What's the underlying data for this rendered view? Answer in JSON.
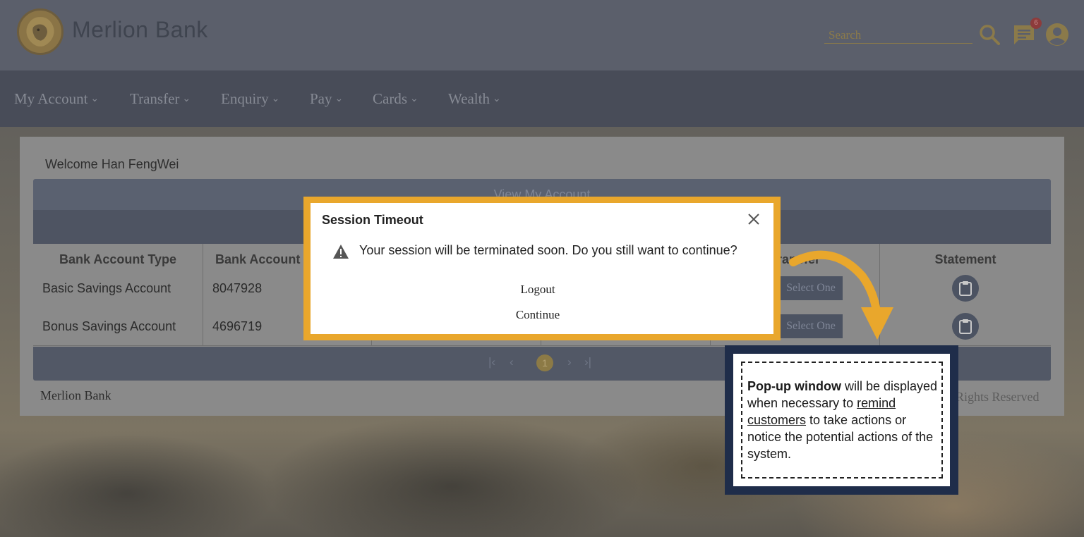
{
  "brand": {
    "name": "Merlion Bank"
  },
  "header": {
    "search_placeholder": "Search",
    "message_count": "6"
  },
  "nav": {
    "items": [
      {
        "label": "My Account"
      },
      {
        "label": "Transfer"
      },
      {
        "label": "Enquiry"
      },
      {
        "label": "Pay"
      },
      {
        "label": "Cards"
      },
      {
        "label": "Wealth"
      }
    ]
  },
  "main": {
    "welcome": "Welcome Han FengWei",
    "table_title": "View My Account",
    "columns": [
      "Bank Account Type",
      "Bank Account",
      "Transfer",
      "Statement"
    ],
    "rows": [
      {
        "type": "Basic Savings Account",
        "number": "8047928",
        "action": "Select One"
      },
      {
        "type": "Bonus Savings Account",
        "number": "4696719",
        "action": "Select One"
      }
    ],
    "pagination": {
      "current_page": "1"
    }
  },
  "footer": {
    "left": "Merlion Bank",
    "right": "Rights Reserved"
  },
  "modal": {
    "title": "Session Timeout",
    "message": "Your session will be terminated soon. Do you still want to continue?",
    "logout_label": "Logout",
    "continue_label": "Continue"
  },
  "annotation": {
    "bold": "Pop-up window",
    "text1": " will be displayed when necessary to ",
    "underline": "remind customers",
    "text2": " to take actions or notice the potential actions of the system."
  },
  "colors": {
    "accent": "#e9a72c",
    "note_frame": "#1f2d4a",
    "header_bg": "#5b5f6b",
    "nav_bg": "#484c58"
  }
}
